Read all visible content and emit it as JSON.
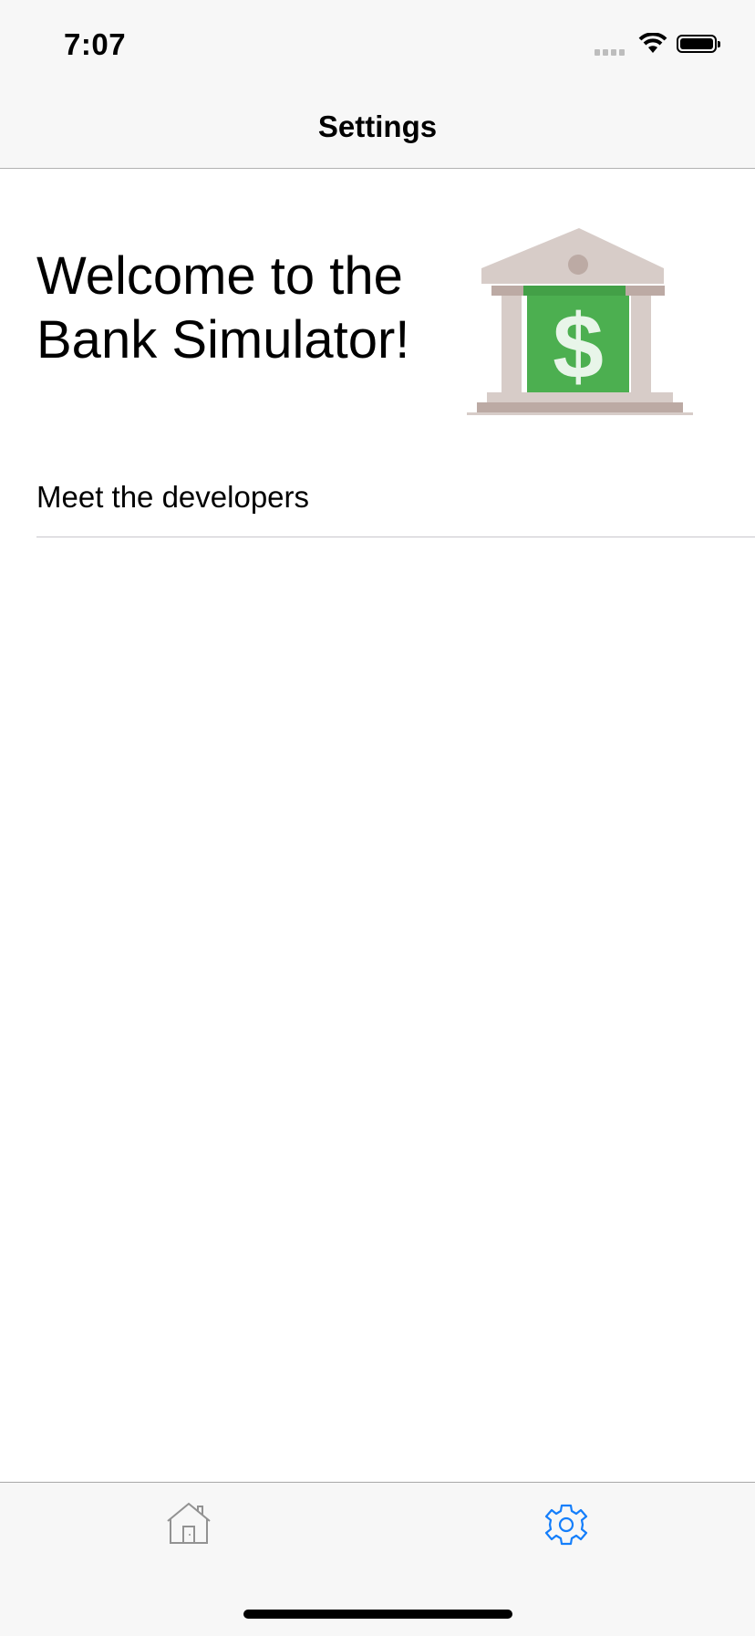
{
  "status_bar": {
    "time": "7:07"
  },
  "nav": {
    "title": "Settings"
  },
  "main": {
    "welcome_line1": "Welcome to the",
    "welcome_line2": "Bank Simulator!",
    "rows": [
      {
        "label": "Meet the developers"
      }
    ]
  },
  "tab_bar": {
    "tabs": [
      {
        "icon": "home-icon",
        "active": false
      },
      {
        "icon": "gear-icon",
        "active": true
      }
    ],
    "active_color": "#147efb",
    "inactive_color": "#929292"
  }
}
